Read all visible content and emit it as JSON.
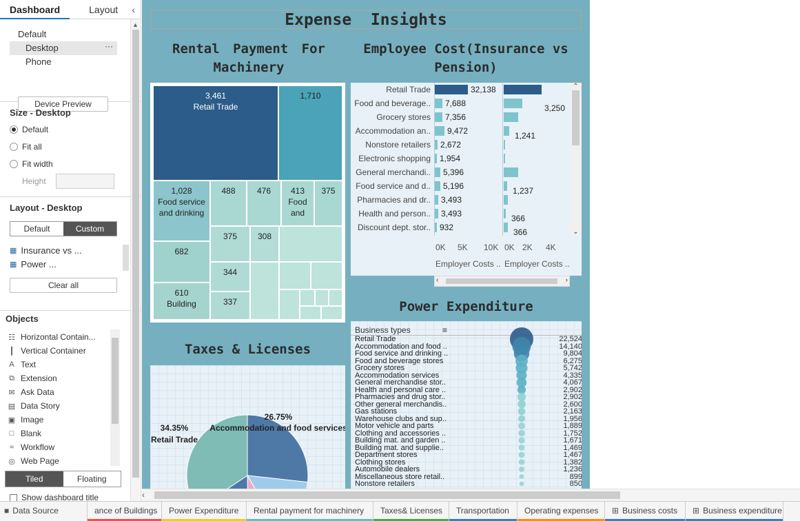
{
  "sidebar": {
    "tabs": [
      "Dashboard",
      "Layout"
    ],
    "collapse_icon": "chevron-left-icon",
    "devices": [
      "Default",
      "Desktop",
      "Phone"
    ],
    "device_preview_label": "Device Preview",
    "size_title": "Size - Desktop",
    "size_options": [
      "Default",
      "Fit all",
      "Fit width"
    ],
    "height_label": "Height",
    "layout_title": "Layout - Desktop",
    "layout_buttons": [
      "Default",
      "Custom"
    ],
    "sheets": [
      "Insurance vs ...",
      "Power ..."
    ],
    "clear_all_label": "Clear all",
    "objects_title": "Objects",
    "objects": [
      {
        "label": "Horizontal Contain...",
        "icon": "horizontal-container-icon"
      },
      {
        "label": "Vertical Container",
        "icon": "vertical-container-icon"
      },
      {
        "label": "Text",
        "icon": "text-icon"
      },
      {
        "label": "Extension",
        "icon": "extension-icon"
      },
      {
        "label": "Ask Data",
        "icon": "ask-data-icon"
      },
      {
        "label": "Data Story",
        "icon": "data-story-icon"
      },
      {
        "label": "Image",
        "icon": "image-icon"
      },
      {
        "label": "Blank",
        "icon": "blank-icon"
      },
      {
        "label": "Workflow",
        "icon": "workflow-icon"
      },
      {
        "label": "Web Page",
        "icon": "web-page-icon"
      }
    ],
    "tiled_label": "Tiled",
    "floating_label": "Floating",
    "show_title_label": "Show dashboard title"
  },
  "dashboard": {
    "title": "Expense  Insights",
    "rental_title": "Rental  Payment  For Machinery",
    "employee_title": "Employee  Cost(Insurance  vs Pension)",
    "taxes_title": "Taxes & Licenses",
    "power_title": "Power  Expenditure",
    "employee_axis_label_1": "Employer Costs ..",
    "employee_axis_label_2": "Employer Costs ..",
    "employee_ticks_1": [
      "0K",
      "5K",
      "10K"
    ],
    "employee_ticks_2": [
      "0K",
      "2K",
      "4K"
    ],
    "power_header": "Business types"
  },
  "treemap": [
    {
      "value": "3,461",
      "label": "Retail Trade"
    },
    {
      "value": "1,710",
      "label": ""
    },
    {
      "value": "1,028",
      "label": "Food service and drinking"
    },
    {
      "value": "488",
      "label": ""
    },
    {
      "value": "476",
      "label": ""
    },
    {
      "value": "413",
      "label": "Food and"
    },
    {
      "value": "375",
      "label": ""
    },
    {
      "value": "375",
      "label": ""
    },
    {
      "value": "308",
      "label": ""
    },
    {
      "value": "682",
      "label": ""
    },
    {
      "value": "344",
      "label": ""
    },
    {
      "value": "610",
      "label": "Building"
    },
    {
      "value": "337",
      "label": ""
    }
  ],
  "employee_rows": [
    {
      "label": "Retail Trade",
      "insurance": 32138,
      "insurance_label": "32,138",
      "pension": 3250,
      "pension_label": ""
    },
    {
      "label": "Food and beverage..",
      "insurance": 7688,
      "insurance_label": "7,688",
      "pension": 1600,
      "pension_label": "3,250"
    },
    {
      "label": "Grocery stores",
      "insurance": 7356,
      "insurance_label": "7,356",
      "pension": 1241,
      "pension_label": ""
    },
    {
      "label": "Accommodation an..",
      "insurance": 9472,
      "insurance_label": "9,472",
      "pension": 500,
      "pension_label": "1,241"
    },
    {
      "label": "Nonstore retailers",
      "insurance": 2672,
      "insurance_label": "2,672",
      "pension": 80,
      "pension_label": ""
    },
    {
      "label": "Electronic shopping",
      "insurance": 1954,
      "insurance_label": "1,954",
      "pension": 60,
      "pension_label": ""
    },
    {
      "label": "General merchandi..",
      "insurance": 5396,
      "insurance_label": "5,396",
      "pension": 1237,
      "pension_label": ""
    },
    {
      "label": "Food service and d..",
      "insurance": 5196,
      "insurance_label": "5,196",
      "pension": 300,
      "pension_label": "1,237"
    },
    {
      "label": "Pharmacies and dr..",
      "insurance": 3493,
      "insurance_label": "3,493",
      "pension": 366,
      "pension_label": ""
    },
    {
      "label": "Health and person..",
      "insurance": 3493,
      "insurance_label": "3,493",
      "pension": 200,
      "pension_label": "366"
    },
    {
      "label": "Discount dept. stor..",
      "insurance": 932,
      "insurance_label": "932",
      "pension": 366,
      "pension_label": "366"
    }
  ],
  "pie": {
    "slices": [
      {
        "label": "Retail Trade",
        "pct": "34.35%",
        "value": 34.35,
        "color": "#7fbcb5"
      },
      {
        "label": "Accommodation and food services",
        "pct": "26.75%",
        "value": 26.75,
        "color": "#4e79a7"
      },
      {
        "label": "",
        "pct": "",
        "value": 15,
        "color": "#a0cbe8"
      },
      {
        "label": "",
        "pct": "",
        "value": 8,
        "color": "#f1a7c5"
      },
      {
        "label": "",
        "pct": "",
        "value": 15.9,
        "color": "#4e79a7"
      }
    ]
  },
  "power_rows": [
    {
      "label": "Retail Trade",
      "value": "22,524",
      "num": 22524
    },
    {
      "label": "Accommodation and food ..",
      "value": "14,140",
      "num": 14140
    },
    {
      "label": "Food service and drinking ..",
      "value": "9,804",
      "num": 9804
    },
    {
      "label": "Food and beverage stores",
      "value": "6,275",
      "num": 6275
    },
    {
      "label": "Grocery stores",
      "value": "5,742",
      "num": 5742
    },
    {
      "label": "Accommodation services",
      "value": "4,335",
      "num": 4335
    },
    {
      "label": "General merchandise stor..",
      "value": "4,067",
      "num": 4067
    },
    {
      "label": "Health and personal care ..",
      "value": "2,902",
      "num": 2902
    },
    {
      "label": "Pharmacies and drug stor..",
      "value": "2,902",
      "num": 2902
    },
    {
      "label": "Other general merchandis..",
      "value": "2,600",
      "num": 2600
    },
    {
      "label": "Gas stations",
      "value": "2,163",
      "num": 2163
    },
    {
      "label": "Warehouse clubs and sup..",
      "value": "1,956",
      "num": 1956
    },
    {
      "label": "Motor vehicle and parts",
      "value": "1,889",
      "num": 1889
    },
    {
      "label": "Clothing and accessories ..",
      "value": "1,752",
      "num": 1752
    },
    {
      "label": "Building mat. and garden ..",
      "value": "1,671",
      "num": 1671
    },
    {
      "label": "Building mat. and supplie..",
      "value": "1,469",
      "num": 1469
    },
    {
      "label": "Department stores",
      "value": "1,467",
      "num": 1467
    },
    {
      "label": "Clothing stores",
      "value": "1,382",
      "num": 1382
    },
    {
      "label": "Automobile dealers",
      "value": "1,236",
      "num": 1236
    },
    {
      "label": "Miscellaneous store retail..",
      "value": "899",
      "num": 899
    },
    {
      "label": "Nonstore retailers",
      "value": "850",
      "num": 850
    }
  ],
  "bottom_tabs": [
    {
      "label": "Data Source",
      "icon": "data-source-icon",
      "color": ""
    },
    {
      "label": "ance of Buildings",
      "icon": "",
      "color": "#e15759"
    },
    {
      "label": "Power  Expenditure",
      "icon": "",
      "color": "#edc948"
    },
    {
      "label": "Rental payment for machinery",
      "icon": "",
      "color": "#76b7b2"
    },
    {
      "label": "Taxes& Licenses",
      "icon": "",
      "color": "#59a14f"
    },
    {
      "label": "Transportation",
      "icon": "",
      "color": "#4e79a7"
    },
    {
      "label": "Operating  expenses",
      "icon": "",
      "color": "#f28e2b"
    },
    {
      "label": "Business costs",
      "icon": "dashboard-grid-icon",
      "color": "#4e79a7"
    },
    {
      "label": "Business expenditure",
      "icon": "dashboard-grid-icon",
      "color": "#4e79a7"
    }
  ]
}
